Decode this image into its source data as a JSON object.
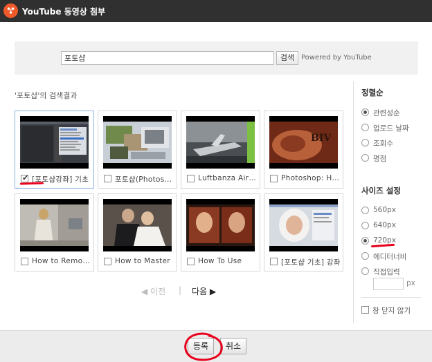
{
  "window": {
    "title": "YouTube 동영상 첨부",
    "logo_icon": "daum-flower-icon"
  },
  "search": {
    "value": "포토샵",
    "button_label": "검색",
    "powered_by": "Powered by YouTube"
  },
  "results": {
    "heading": "'포토샵'의 검색결과",
    "items": [
      {
        "label": "[포토샵강좌] 기초",
        "checked": true,
        "thumb": "photoshop-screenshot"
      },
      {
        "label": "포토샵(Photoshop)",
        "checked": false,
        "thumb": "photoshop-collage"
      },
      {
        "label": "Luftbanza Airlines",
        "checked": false,
        "thumb": "airplane-art"
      },
      {
        "label": "Photoshop: How to",
        "checked": false,
        "thumb": "tattoo-arm"
      },
      {
        "label": "How to Remove",
        "checked": false,
        "thumb": "woman-street"
      },
      {
        "label": "How to Master",
        "checked": false,
        "thumb": "wedding-couple"
      },
      {
        "label": "How To Use",
        "checked": false,
        "thumb": "portrait-frames"
      },
      {
        "label": "[포토샵 기초] 강좌",
        "checked": false,
        "thumb": "baby-portrait"
      }
    ]
  },
  "pager": {
    "prev_label": "◀ 이전",
    "separator": "|",
    "next_label": "다음 ▶"
  },
  "sort": {
    "title": "정렬순",
    "options": [
      {
        "label": "관련성순",
        "selected": true
      },
      {
        "label": "업로드 날짜",
        "selected": false
      },
      {
        "label": "조회수",
        "selected": false
      },
      {
        "label": "평점",
        "selected": false
      }
    ]
  },
  "size": {
    "title": "사이즈 설정",
    "options": [
      {
        "label": "560px",
        "selected": false
      },
      {
        "label": "640px",
        "selected": false
      },
      {
        "label": "720px",
        "selected": true
      },
      {
        "label": "에디터너비",
        "selected": false
      },
      {
        "label": "직접입력",
        "selected": false
      }
    ],
    "custom_unit": "px",
    "custom_value": ""
  },
  "keep_open": {
    "label": "창 닫지 않기",
    "checked": false
  },
  "footer": {
    "ok_label": "등록",
    "cancel_label": "취소"
  },
  "colors": {
    "titlebar": "#303030",
    "accent_logo": "#f05a2a",
    "annotation_red": "#e8001c"
  }
}
